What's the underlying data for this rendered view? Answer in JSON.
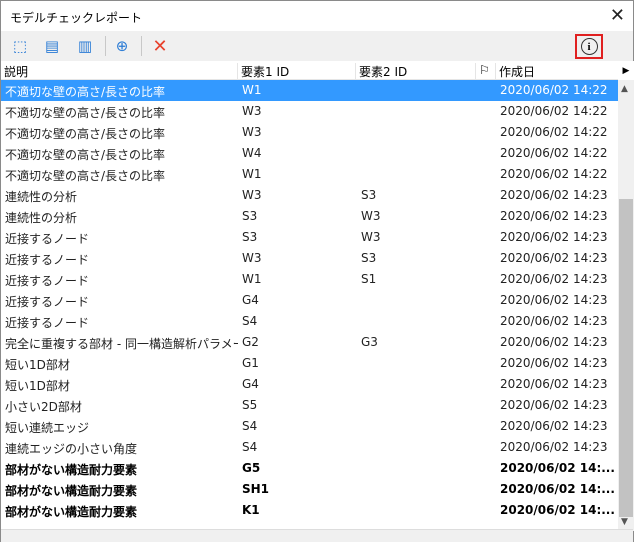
{
  "window": {
    "title": "モデルチェックレポート",
    "close_label": "✕"
  },
  "toolbar": {
    "icons": [
      "select-elements-icon",
      "report-icon-1",
      "report-icon-2",
      "add-report-icon",
      "delete-icon",
      "info-icon"
    ],
    "delete_label": "✕",
    "info_label": "i"
  },
  "table": {
    "columns": [
      "説明",
      "要素1 ID",
      "要素2 ID",
      "⚐",
      "作成日"
    ],
    "rows": [
      {
        "desc": "不適切な壁の高さ/長さの比率",
        "id1": "W1",
        "id2": "",
        "date": "2020/06/02 14:22",
        "selected": true
      },
      {
        "desc": "不適切な壁の高さ/長さの比率",
        "id1": "W3",
        "id2": "",
        "date": "2020/06/02 14:22"
      },
      {
        "desc": "不適切な壁の高さ/長さの比率",
        "id1": "W3",
        "id2": "",
        "date": "2020/06/02 14:22"
      },
      {
        "desc": "不適切な壁の高さ/長さの比率",
        "id1": "W4",
        "id2": "",
        "date": "2020/06/02 14:22"
      },
      {
        "desc": "不適切な壁の高さ/長さの比率",
        "id1": "W1",
        "id2": "",
        "date": "2020/06/02 14:22"
      },
      {
        "desc": "連続性の分析",
        "id1": "W3",
        "id2": "S3",
        "date": "2020/06/02 14:23"
      },
      {
        "desc": "連続性の分析",
        "id1": "S3",
        "id2": "W3",
        "date": "2020/06/02 14:23"
      },
      {
        "desc": "近接するノード",
        "id1": "S3",
        "id2": "W3",
        "date": "2020/06/02 14:23"
      },
      {
        "desc": "近接するノード",
        "id1": "W3",
        "id2": "S3",
        "date": "2020/06/02 14:23"
      },
      {
        "desc": "近接するノード",
        "id1": "W1",
        "id2": "S1",
        "date": "2020/06/02 14:23"
      },
      {
        "desc": "近接するノード",
        "id1": "G4",
        "id2": "",
        "date": "2020/06/02 14:23"
      },
      {
        "desc": "近接するノード",
        "id1": "S4",
        "id2": "",
        "date": "2020/06/02 14:23"
      },
      {
        "desc": "完全に重複する部材 - 同一構造解析パラメータ",
        "id1": "G2",
        "id2": "G3",
        "date": "2020/06/02 14:23"
      },
      {
        "desc": "短い1D部材",
        "id1": "G1",
        "id2": "",
        "date": "2020/06/02 14:23"
      },
      {
        "desc": "短い1D部材",
        "id1": "G4",
        "id2": "",
        "date": "2020/06/02 14:23"
      },
      {
        "desc": "小さい2D部材",
        "id1": "S5",
        "id2": "",
        "date": "2020/06/02 14:23"
      },
      {
        "desc": "短い連続エッジ",
        "id1": "S4",
        "id2": "",
        "date": "2020/06/02 14:23"
      },
      {
        "desc": "連続エッジの小さい角度",
        "id1": "S4",
        "id2": "",
        "date": "2020/06/02 14:23"
      },
      {
        "desc": "部材がない構造耐力要素",
        "id1": "G5",
        "id2": "",
        "date": "2020/06/02 14:...",
        "bold": true
      },
      {
        "desc": "部材がない構造耐力要素",
        "id1": "SH1",
        "id2": "",
        "date": "2020/06/02 14:...",
        "bold": true
      },
      {
        "desc": "部材がない構造耐力要素",
        "id1": "K1",
        "id2": "",
        "date": "2020/06/02 14:...",
        "bold": true
      }
    ]
  },
  "scroll": {
    "up": "▲",
    "down": "▼",
    "right": "▶"
  },
  "colors": {
    "selection": "#3399ff",
    "delete": "#e8412c",
    "highlight": "#e02020"
  }
}
